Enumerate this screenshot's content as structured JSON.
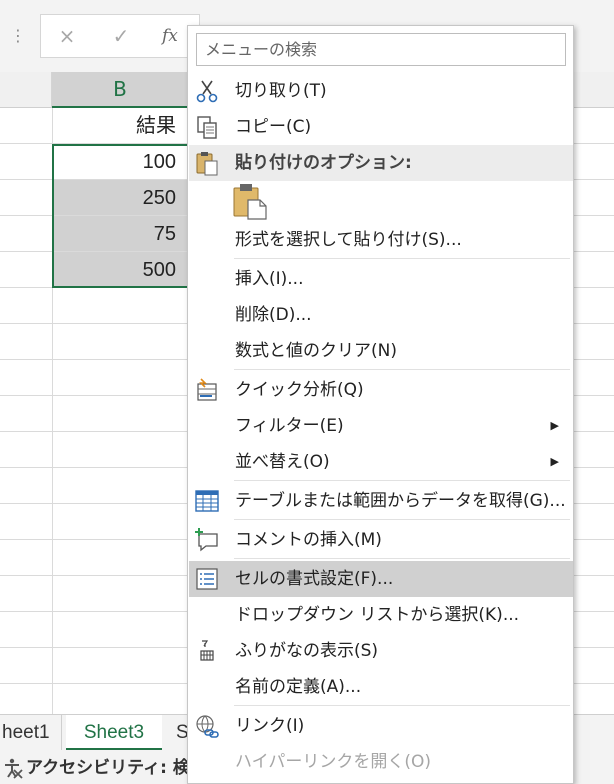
{
  "formula_bar": {
    "more_icon": "vertical-ellipsis",
    "cancel_icon": "×",
    "enter_icon": "✓",
    "fx_label": "fx"
  },
  "column_b_header": "B",
  "cells": {
    "b1": "結果",
    "b2": "100",
    "b3": "250",
    "b4": "75",
    "b5": "500"
  },
  "sheet_tabs": {
    "sheet1": "heet1",
    "sheet3": "Sheet3",
    "next": "S"
  },
  "status_bar": {
    "accessibility": "アクセシビリティ: 検討"
  },
  "context_menu": {
    "search_placeholder": "メニューの検索",
    "cut": "切り取り(T)",
    "copy": "コピー(C)",
    "paste_options": "貼り付けのオプション:",
    "paste_special": "形式を選択して貼り付け(S)...",
    "insert": "挿入(I)...",
    "delete": "削除(D)...",
    "clear_contents": "数式と値のクリア(N)",
    "quick_analysis": "クイック分析(Q)",
    "filter": "フィルター(E)",
    "sort": "並べ替え(O)",
    "get_data": "テーブルまたは範囲からデータを取得(G)...",
    "insert_comment": "コメントの挿入(M)",
    "format_cells": "セルの書式設定(F)...",
    "dropdown_pick": "ドロップダウン リストから選択(K)...",
    "phonetic": "ふりがなの表示(S)",
    "define_name": "名前の定義(A)...",
    "link": "リンク(I)",
    "open_hyperlink": "ハイパーリンクを開く(O)",
    "submenu_arrow": "▶"
  },
  "colors": {
    "excel_green": "#217346",
    "selection_gray": "#d1d1d1",
    "hover_gray": "#d0d0d0"
  }
}
